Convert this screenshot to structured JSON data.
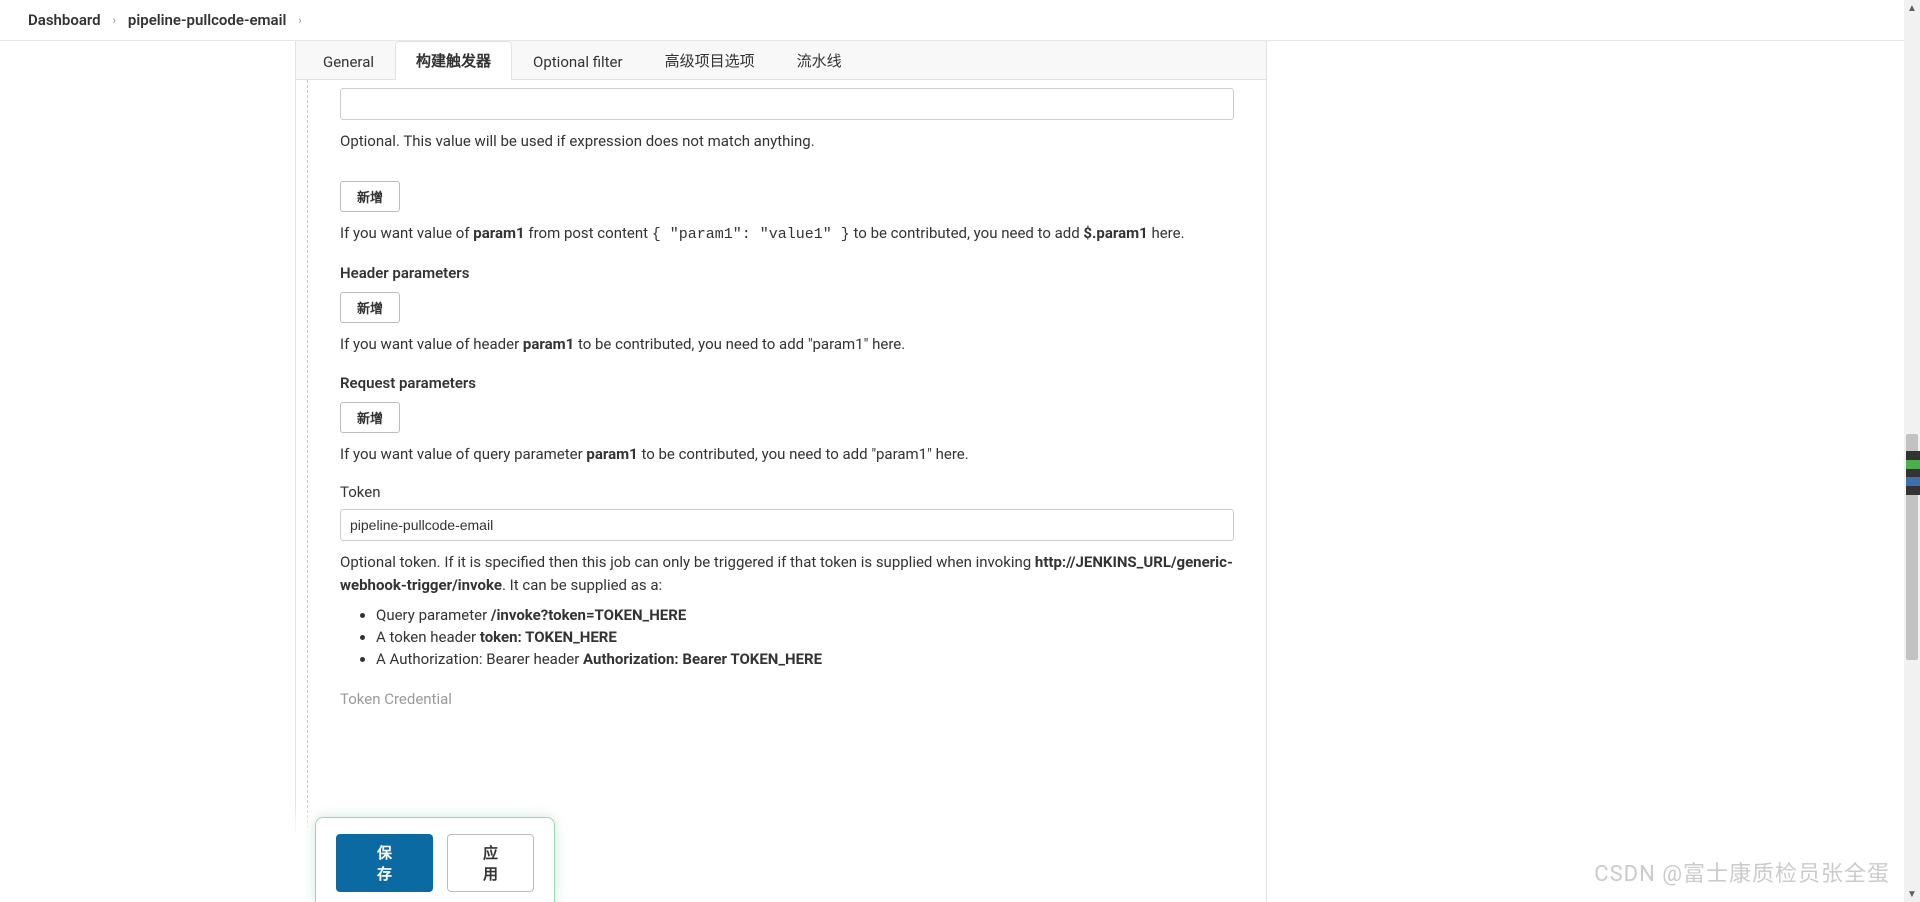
{
  "breadcrumb": {
    "items": [
      "Dashboard",
      "pipeline-pullcode-email"
    ]
  },
  "tabs": {
    "general": "General",
    "triggers": "构建触发器",
    "optional_filter": "Optional filter",
    "advanced": "高级项目选项",
    "pipeline": "流水线"
  },
  "section_optional": {
    "help": "Optional. This value will be used if expression does not match anything."
  },
  "btn_add": "新增",
  "post_content_help": {
    "prefix": "If you want value of ",
    "param": "param1",
    "mid": " from post content ",
    "json": "{ \"param1\": \"value1\" }",
    "mid2": " to be contributed, you need to add ",
    "jsonpath": "$.param1",
    "suffix": " here."
  },
  "header_params": {
    "label": "Header parameters",
    "help_prefix": "If you want value of header ",
    "help_param": "param1",
    "help_suffix": " to be contributed, you need to add \"param1\" here."
  },
  "request_params": {
    "label": "Request parameters",
    "help_prefix": "If you want value of query parameter ",
    "help_param": "param1",
    "help_suffix": " to be contributed, you need to add \"param1\" here."
  },
  "token": {
    "label": "Token",
    "value": "pipeline-pullcode-email",
    "help_prefix": "Optional token. If it is specified then this job can only be triggered if that token is supplied when invoking ",
    "url": "http://JENKINS_URL/generic-webhook-trigger/invoke",
    "help_suffix": ". It can be supplied as a:",
    "bullets": {
      "b1_prefix": "Query parameter ",
      "b1_bold": "/invoke?token=TOKEN_HERE",
      "b2_prefix": "A token header ",
      "b2_bold": "token: TOKEN_HERE",
      "b3_prefix": "A Authorization: Bearer header ",
      "b3_bold": "Authorization: Bearer TOKEN_HERE"
    }
  },
  "token_credential_label": "Token Credential",
  "footer": {
    "save": "保存",
    "apply": "应用"
  },
  "watermark": "CSDN @富士康质检员张全蛋"
}
